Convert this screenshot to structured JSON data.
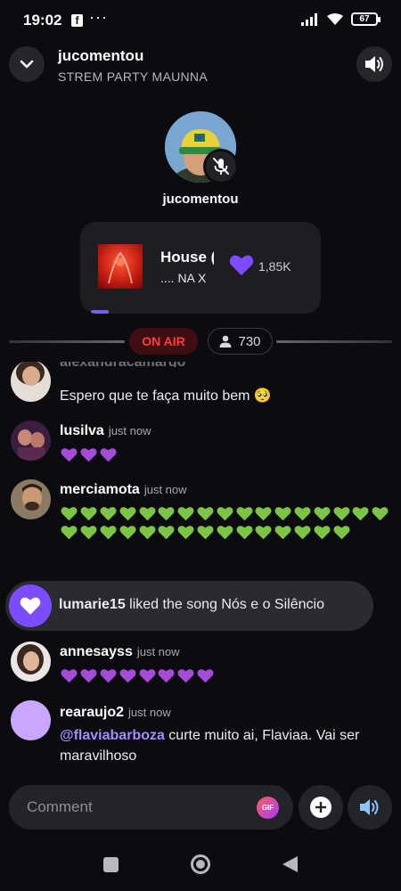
{
  "status_bar": {
    "time": "19:02",
    "fb_glyph": "f",
    "more": "···",
    "battery": "67"
  },
  "header": {
    "host": "jucomentou",
    "room": "STREM PARTY MAUNNA"
  },
  "stage": {
    "host_label": "jucomentou"
  },
  "song": {
    "title": "House (",
    "artist": "....  NA X",
    "likes": "1,85K"
  },
  "badges": {
    "onair": "ON AIR",
    "listeners": "730"
  },
  "messages": [
    {
      "user": "alexandracamargo",
      "text": "Espero que te faça muito bem 🥺"
    },
    {
      "user": "lusilva",
      "time": "just now",
      "hearts": 3,
      "heart_color": "#a44bd8"
    },
    {
      "user": "merciamota",
      "time": "just now",
      "hearts": 32,
      "heart_color": "#7cc443"
    },
    {
      "user": "annesayss",
      "time": "just now",
      "hearts": 8,
      "heart_color": "#a44bd8"
    },
    {
      "user": "rearaujo2",
      "time": "just now",
      "mention": "@flaviabarboza",
      "text": " curte muito ai, Flaviaa. Vai ser maravilhoso"
    }
  ],
  "like_event": {
    "user": "lumarie15",
    "text": " liked the song Nós e o Silêncio"
  },
  "composer": {
    "placeholder": "Comment",
    "gif": "GIF"
  },
  "colors": {
    "accent": "#7b4dff",
    "onair": "#ff3b3b"
  },
  "icons": [
    "chevron-down-icon",
    "speaker-icon",
    "mic-off-icon",
    "heart-icon",
    "person-icon",
    "plus-icon",
    "gif-icon"
  ]
}
